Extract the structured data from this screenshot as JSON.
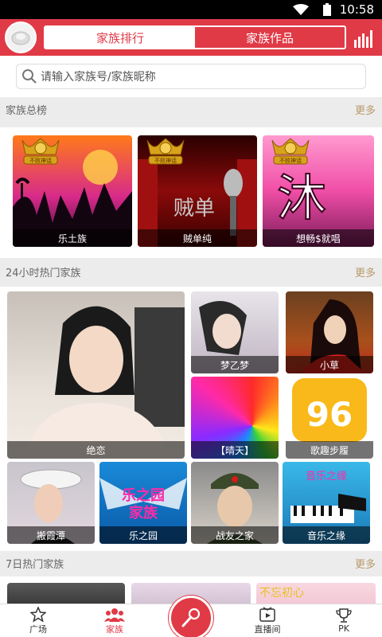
{
  "status": {
    "time": "10:58"
  },
  "header": {
    "tabs": [
      {
        "label": "家族排行",
        "active": true
      },
      {
        "label": "家族作品",
        "active": false
      }
    ]
  },
  "search": {
    "placeholder": "请输入家族号/家族昵称"
  },
  "sections": [
    {
      "title": "家族总榜",
      "more": "更多"
    },
    {
      "title": "24小时热门家族",
      "more": "更多"
    },
    {
      "title": "7日热门家族",
      "more": "更多"
    }
  ],
  "top_families": [
    {
      "name": "乐土族",
      "badge": "不败神话"
    },
    {
      "name": "贼单纯",
      "badge": "不败神话"
    },
    {
      "name": "想畅$就唱",
      "badge": "不败神话"
    }
  ],
  "hot24": [
    {
      "name": "绝恋"
    },
    {
      "name": "梦乙梦"
    },
    {
      "name": "小草"
    },
    {
      "name": "【晴天】"
    },
    {
      "name": "歌趣步履"
    },
    {
      "name": "搬霞潭"
    },
    {
      "name": "乐之园"
    },
    {
      "name": "战友之家"
    },
    {
      "name": "音乐之缘"
    }
  ],
  "hot7_partial_text": "不忘初心",
  "bottom_nav": [
    {
      "label": "广场",
      "icon": "star-icon"
    },
    {
      "label": "家族",
      "icon": "family-icon",
      "active": true
    },
    {
      "label": "",
      "icon": "microphone-icon"
    },
    {
      "label": "直播间",
      "icon": "live-room-icon"
    },
    {
      "label": "PK",
      "icon": "trophy-icon"
    }
  ],
  "colors": {
    "brand": "#e03a46",
    "more": "#b89a6a"
  }
}
